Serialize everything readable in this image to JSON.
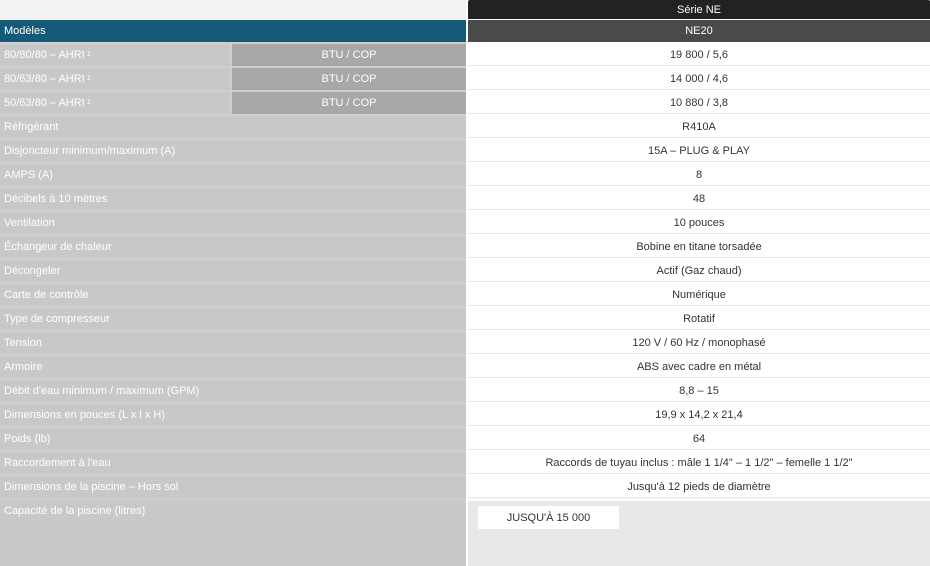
{
  "header": {
    "series": "Série NE",
    "models_label": "Modèles",
    "model_name": "NE20"
  },
  "performance": [
    {
      "label": "80/80/80 – AHRI",
      "note": "1",
      "unit": "BTU / COP",
      "value": "19 800 / 5,6"
    },
    {
      "label": "80/63/80 – AHRI",
      "note": "1",
      "unit": "BTU / COP",
      "value": "14 000 / 4,6"
    },
    {
      "label": "50/63/80 – AHRI",
      "note": "1",
      "unit": "BTU / COP",
      "value": "10 880 / 3,8"
    }
  ],
  "specs": [
    {
      "label": "Réfrigérant",
      "value": "R410A"
    },
    {
      "label": "Disjoncteur minimum/maximum (A)",
      "value": "15A – PLUG & PLAY"
    },
    {
      "label": "AMPS (A)",
      "value": "8"
    },
    {
      "label": "Décibels à 10 mètres",
      "value": "48"
    },
    {
      "label": "Ventilation",
      "value": "10 pouces"
    },
    {
      "label": "Échangeur de chaleur",
      "value": "Bobine en titane torsadée"
    },
    {
      "label": "Décongeler",
      "value": "Actif (Gaz chaud)"
    },
    {
      "label": "Carte de contrôle",
      "value": "Numérique"
    },
    {
      "label": "Type de compresseur",
      "value": "Rotatif"
    },
    {
      "label": "Tension",
      "value": "120 V / 60 Hz / monophasé"
    },
    {
      "label": "Armoire",
      "value": "ABS avec cadre en métal"
    },
    {
      "label": "Débit d'eau minimum / maximum (GPM)",
      "value": "8,8 – 15"
    },
    {
      "label": "Dimensions en pouces (L x l x H)",
      "value": "19,9 x 14,2 x 21,4"
    },
    {
      "label": "Poids (lb)",
      "value": "64"
    },
    {
      "label": "Raccordement à l'eau",
      "value": "Raccords de tuyau inclus : mâle 1 1/4\" – 1 1/2\" – femelle 1 1/2\""
    },
    {
      "label": "Dimensions de la piscine – Hors sol",
      "value": "Jusqu'à 12 pieds de diamètre"
    }
  ],
  "pool_capacity": {
    "label": "Capacité de la piscine (litres)",
    "value": "JUSQU'À 15 000"
  },
  "colors": {
    "header_dark": "#222222",
    "models_blue": "#155a77",
    "model_gray": "#4a4a4a",
    "label_gray": "#c8c8c8",
    "unit_gray": "#a8a8a8"
  }
}
